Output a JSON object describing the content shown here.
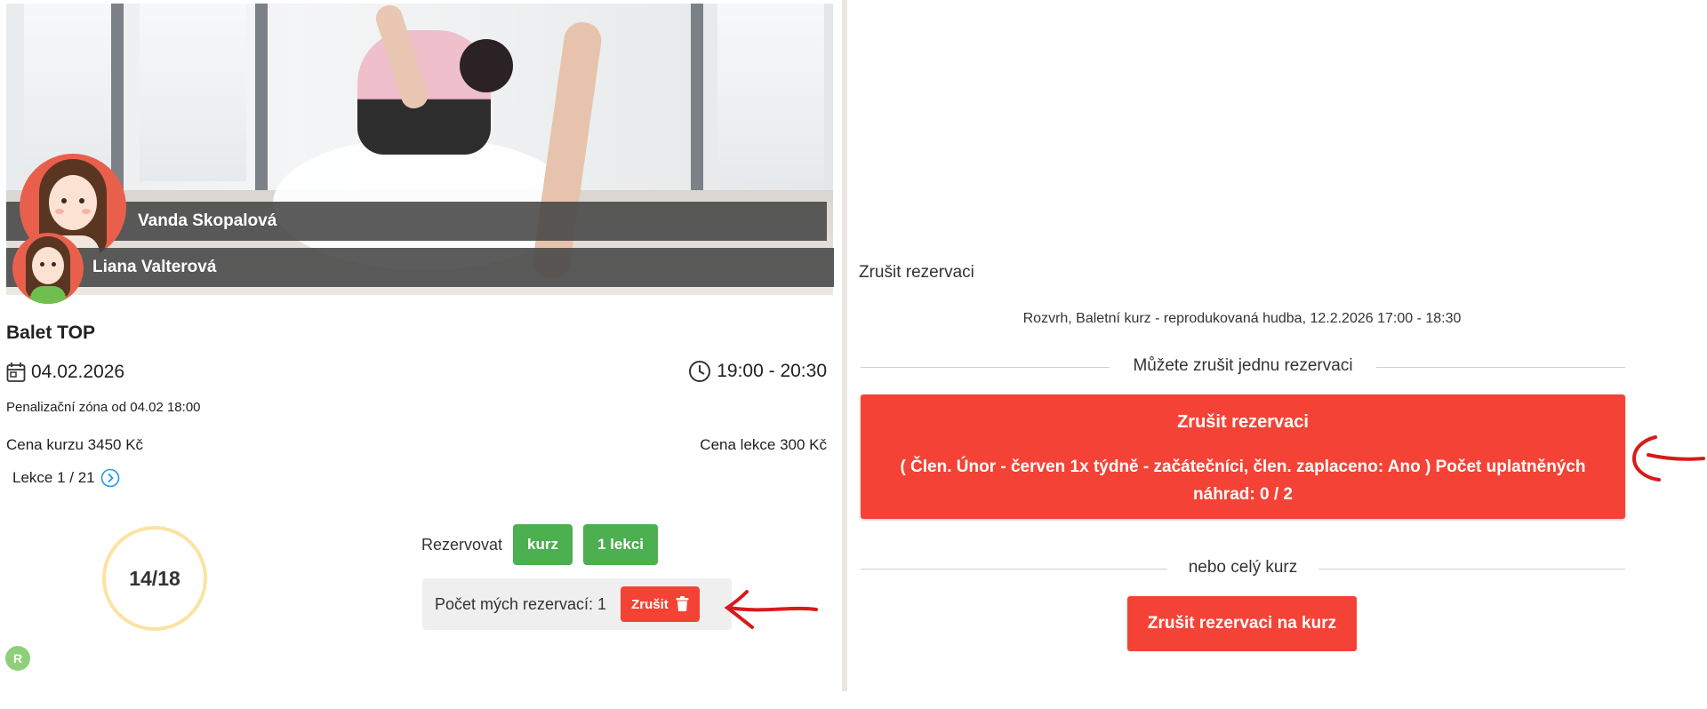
{
  "instructors": [
    {
      "name": "Vanda Skopalová"
    },
    {
      "name": "Liana Valterová"
    }
  ],
  "course": {
    "title": "Balet TOP",
    "date": "04.02.2026",
    "time": "19:00 - 20:30",
    "penalty_zone": "Penalizační zóna od 04.02 18:00",
    "course_price": "Cena kurzu 3450 Kč",
    "lesson_price": "Cena lekce 300 Kč",
    "lesson_counter": "Lekce 1 / 21",
    "capacity": "14/18",
    "capacity_occupied": 14,
    "capacity_total": 18,
    "badge": "R"
  },
  "reserve": {
    "label": "Rezervovat",
    "course_button": "kurz",
    "lesson_button": "1 lekci"
  },
  "my_reservations": {
    "label": "Počet mých rezervací: 1",
    "cancel_button": "Zrušit"
  },
  "cancel_panel": {
    "heading": "Zrušit rezervaci",
    "event": "Rozvrh, Baletní kurz - reprodukovaná hudba, 12.2.2026 17:00 - 18:30",
    "single_separator": "Můžete zrušit jednu rezervaci",
    "single_button_title": "Zrušit rezervaci",
    "single_button_detail": "( Člen. Únor - červen 1x týdně - začátečníci, člen. zaplaceno: Ano   ) Počet uplatněných náhrad: 0 / 2",
    "course_separator": "nebo celý kurz",
    "course_button": "Zrušit rezervaci na kurz"
  },
  "colors": {
    "accent_red": "#f44336",
    "accent_green": "#4caf50",
    "annotation_arrow": "#d91a1a"
  },
  "icons": [
    "calendar-icon",
    "clock-icon",
    "chevron-right-circle-icon",
    "trash-icon",
    "annotation-arrow"
  ]
}
